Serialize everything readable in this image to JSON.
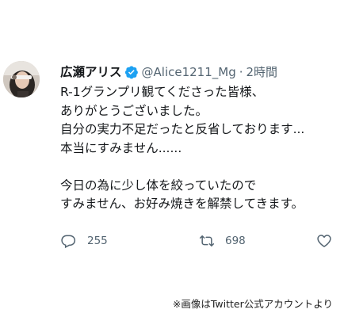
{
  "tweet": {
    "display_name": "広瀬アリス",
    "handle": "@Alice1211_Mg",
    "separator": "·",
    "time": "2時間",
    "lines": [
      "R-1グランプリ観てくださった皆様、",
      "ありがとうございました。",
      "自分の実力不足だったと反省しております...",
      "本当にすみません......",
      "",
      "今日の為に少し体を絞っていたので",
      "すみません、お好み焼きを解禁してきます。"
    ],
    "reply_count": "255",
    "retweet_count": "698"
  },
  "icons": {
    "verified": "verified-badge-icon",
    "reply": "reply-icon",
    "retweet": "retweet-icon",
    "like": "heart-icon",
    "share": "share-icon"
  },
  "colors": {
    "verified_blue": "#1da1f2",
    "secondary_text": "#536471",
    "primary_text": "#14171a"
  },
  "credit": "※画像はTwitter公式アカウントより"
}
